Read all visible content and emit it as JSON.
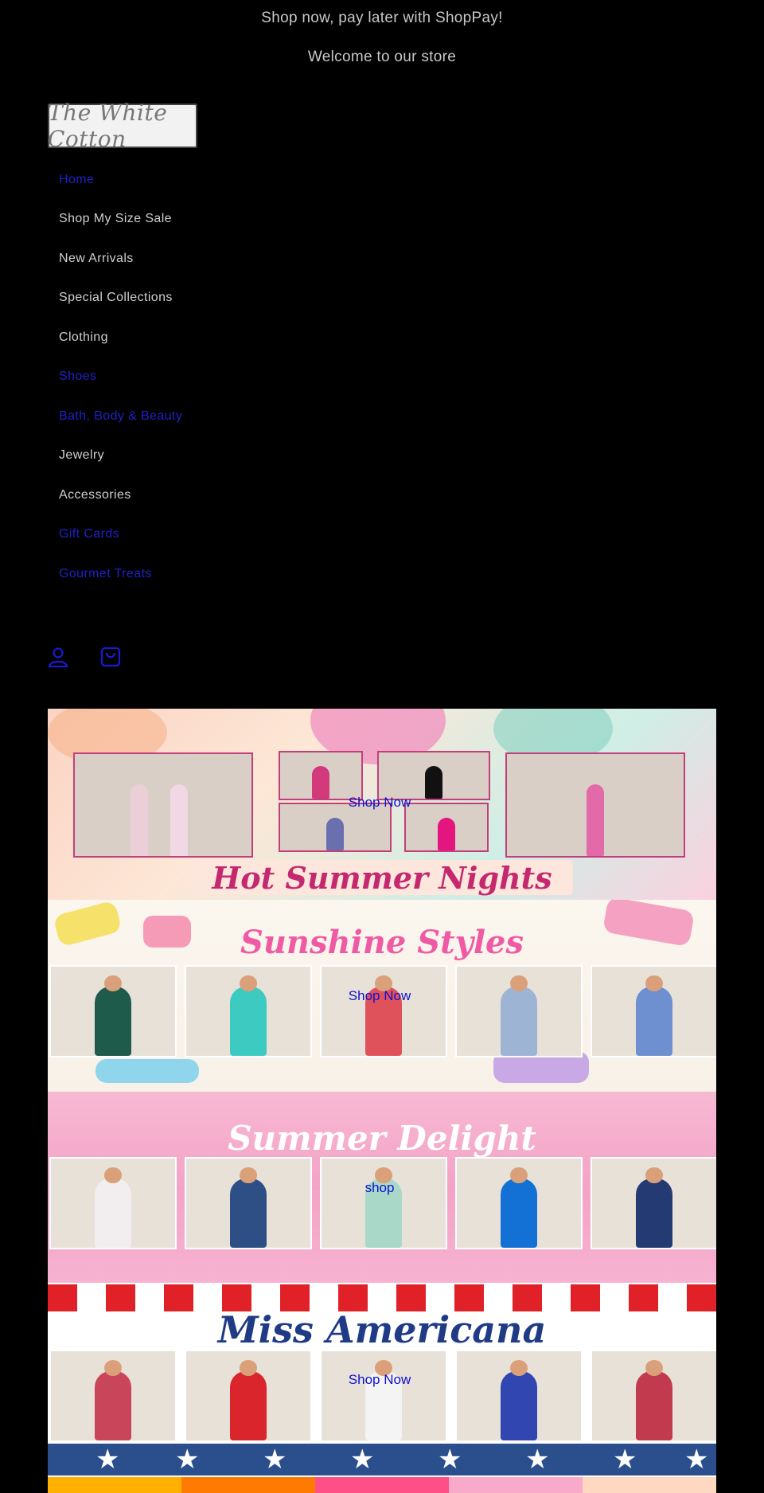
{
  "announcements": [
    "Shop now, pay later with ShopPay!",
    "Welcome to our store"
  ],
  "logo": {
    "text": "The White Cotton"
  },
  "nav": {
    "items": [
      {
        "label": "Home",
        "link": true
      },
      {
        "label": "Shop My Size Sale",
        "link": false
      },
      {
        "label": "New Arrivals",
        "link": false
      },
      {
        "label": "Special Collections",
        "link": false
      },
      {
        "label": "Clothing",
        "link": false
      },
      {
        "label": "Shoes",
        "link": true
      },
      {
        "label": "Bath, Body & Beauty",
        "link": true
      },
      {
        "label": "Jewelry",
        "link": false
      },
      {
        "label": "Accessories",
        "link": false
      },
      {
        "label": "Gift Cards",
        "link": true
      },
      {
        "label": "Gourmet Treats",
        "link": true
      }
    ]
  },
  "header_icons": {
    "account": "account-icon",
    "cart": "cart-icon",
    "color": "#1a1ad0"
  },
  "banners": [
    {
      "title": "Hot Summer Nights",
      "link_label": "Shop Now"
    },
    {
      "title": "Sunshine Styles",
      "link_label": "Shop Now"
    },
    {
      "title": "Summer Delight",
      "link_label": "shop"
    },
    {
      "title": "Miss Americana",
      "link_label": "Shop Now"
    }
  ],
  "colors": {
    "background": "#000000",
    "link": "#1a1ad0",
    "accent_pink": "#c2407a",
    "americana_red": "#e02127",
    "americana_blue": "#2b4e8c"
  }
}
